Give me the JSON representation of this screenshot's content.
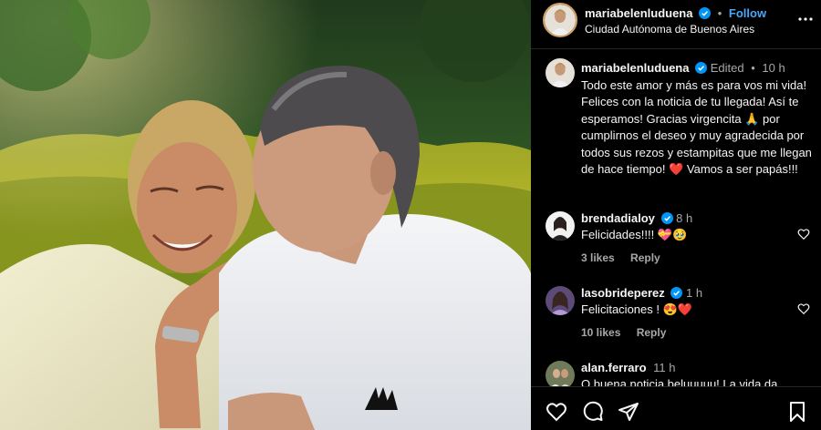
{
  "post": {
    "username": "mariabelenluduena",
    "location": "Ciudad Autónoma de Buenos Aires",
    "follow_label": "Follow",
    "dot": "•"
  },
  "caption": {
    "username": "mariabelenluduena",
    "edited": "Edited",
    "dot": "•",
    "time": "10 h",
    "text": "Todo este amor y más  es para vos mi vida! Felices con la noticia de tu llegada! Así te esperamos! Gracias virgencita 🙏 por cumplirnos el deseo y muy agradecida por todos sus rezos y estampitas que me llegan de hace tiempo! ❤️ Vamos a ser papás!!!"
  },
  "comments": [
    {
      "username": "brendadialoy",
      "time": "8 h",
      "text": "Felicidades!!!! 💝🥹",
      "likes": "3 likes",
      "reply": "Reply"
    },
    {
      "username": "lasobrideperez",
      "time": "1 h",
      "text": "Felicitaciones ! 😍❤️",
      "likes": "10 likes",
      "reply": "Reply"
    },
    {
      "username": "alan.ferraro",
      "time": "11 h",
      "text": "O buena noticia beluuuuu! La vida da"
    }
  ],
  "icons": {
    "more": "more-options-icon",
    "verified": "verified-badge-icon",
    "heart": "heart-outline-icon",
    "like": "like-icon",
    "comment": "comment-icon",
    "share": "share-icon",
    "save": "bookmark-icon"
  },
  "colors": {
    "verified": "#0095f6",
    "follow": "#4aa6f7",
    "muted": "#a8a8a8",
    "background": "#000000"
  }
}
